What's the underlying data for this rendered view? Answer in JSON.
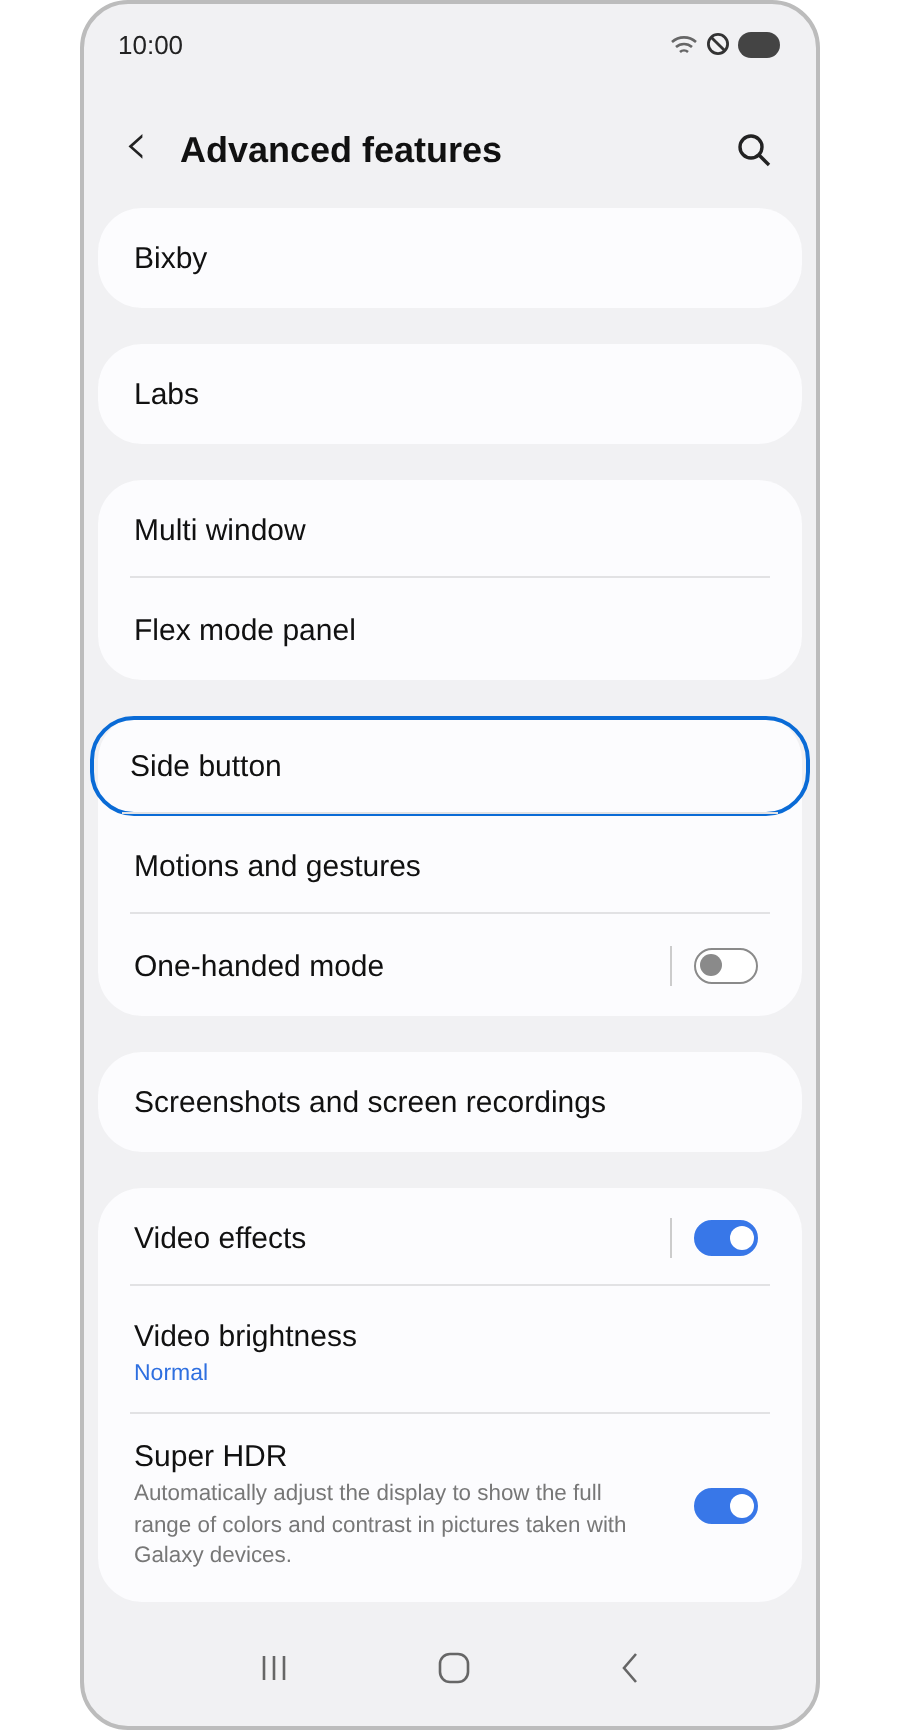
{
  "status_bar": {
    "time": "10:00"
  },
  "header": {
    "back": "‹",
    "title": "Advanced features"
  },
  "groups": [
    {
      "items": [
        {
          "kind": "plain",
          "label": "Bixby",
          "highlighted": false
        }
      ]
    },
    {
      "items": [
        {
          "kind": "plain",
          "label": "Labs",
          "highlighted": false
        }
      ]
    },
    {
      "items": [
        {
          "kind": "plain",
          "label": "Multi window",
          "highlighted": false
        },
        {
          "kind": "plain",
          "label": "Flex mode panel",
          "highlighted": false
        }
      ]
    },
    {
      "items": [
        {
          "kind": "plain",
          "label": "Side button",
          "highlighted": true
        },
        {
          "kind": "plain",
          "label": "Motions and gestures",
          "highlighted": false
        },
        {
          "kind": "split-switch",
          "label": "One-handed mode",
          "on": false,
          "highlighted": false
        }
      ]
    },
    {
      "items": [
        {
          "kind": "plain",
          "label": "Screenshots and screen recordings",
          "highlighted": false
        }
      ]
    },
    {
      "items": [
        {
          "kind": "split-switch",
          "label": "Video effects",
          "on": true,
          "highlighted": false
        },
        {
          "kind": "plain",
          "label": "Video brightness",
          "value": "Normal",
          "highlighted": false
        },
        {
          "kind": "switch",
          "label": "Super HDR",
          "description": "Automatically adjust the display to show the full range of colors and contrast in pictures taken with Galaxy devices.",
          "on": true,
          "highlighted": false
        }
      ]
    }
  ]
}
